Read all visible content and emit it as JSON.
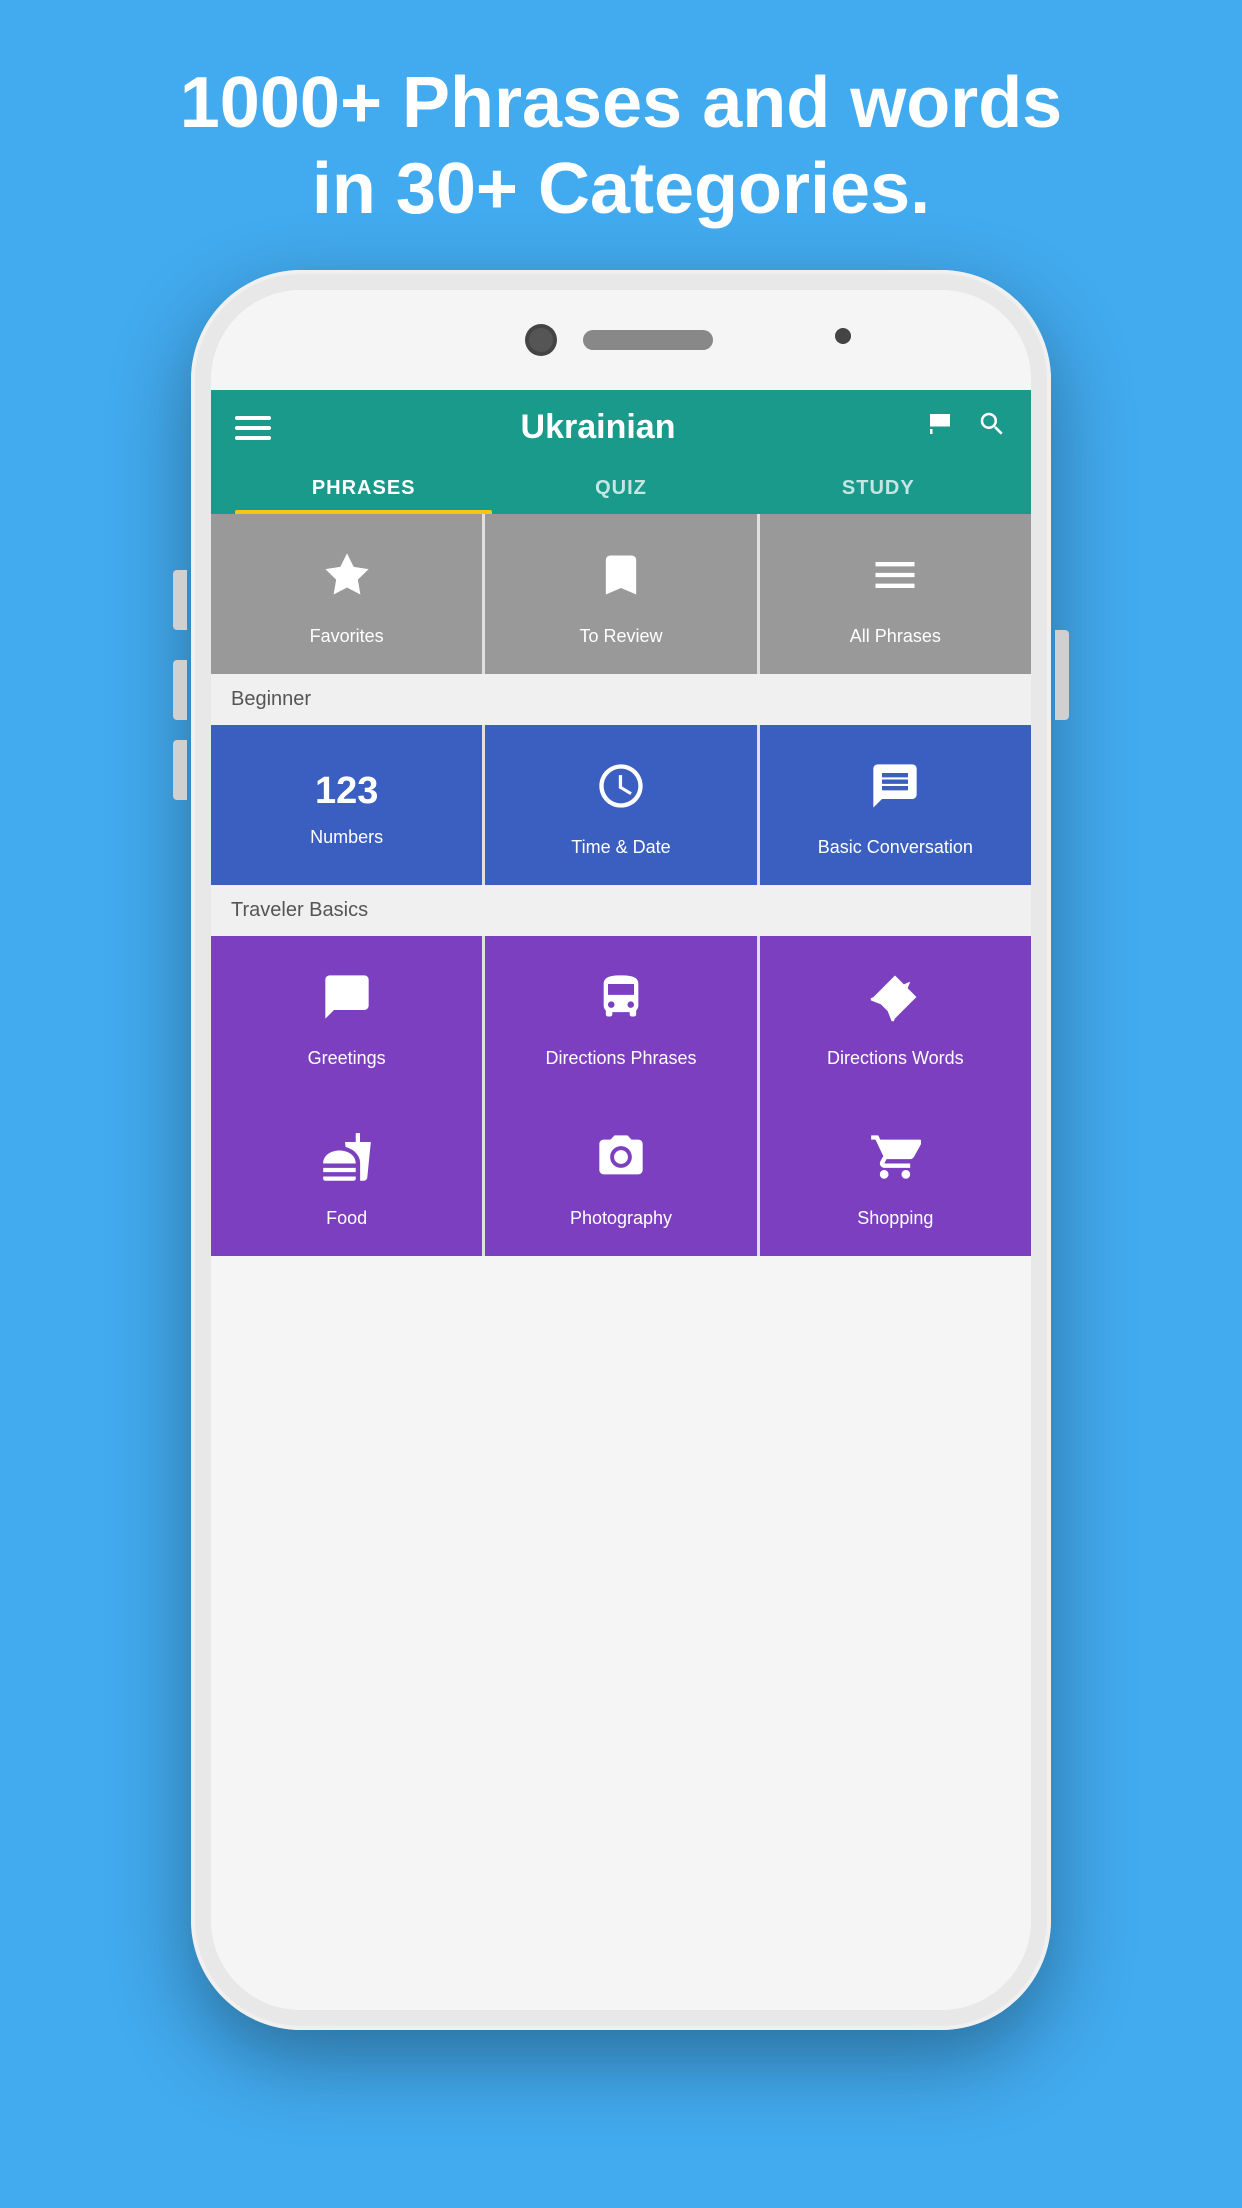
{
  "headline": {
    "line1": "1000+ Phrases and words",
    "line2": "in 30+ Categories."
  },
  "header": {
    "title": "Ukrainian",
    "flag_icon_label": "flag-icon",
    "search_icon_label": "search-icon",
    "menu_icon_label": "menu-icon"
  },
  "tabs": [
    {
      "id": "phrases",
      "label": "PHRASES",
      "active": true
    },
    {
      "id": "quiz",
      "label": "QUIZ",
      "active": false
    },
    {
      "id": "study",
      "label": "STUDY",
      "active": false
    }
  ],
  "grid_top": [
    {
      "id": "favorites",
      "label": "Favorites",
      "icon": "star",
      "color": "gray"
    },
    {
      "id": "to-review",
      "label": "To Review",
      "icon": "bookmark",
      "color": "gray"
    },
    {
      "id": "all-phrases",
      "label": "All Phrases",
      "icon": "lines",
      "color": "gray"
    }
  ],
  "section_beginner": {
    "label": "Beginner"
  },
  "grid_beginner": [
    {
      "id": "numbers",
      "label": "Numbers",
      "icon": "123",
      "color": "blue"
    },
    {
      "id": "time-date",
      "label": "Time & Date",
      "icon": "clock",
      "color": "blue"
    },
    {
      "id": "basic-conversation",
      "label": "Basic Conversation",
      "icon": "chat",
      "color": "blue"
    }
  ],
  "section_traveler": {
    "label": "Traveler Basics"
  },
  "grid_traveler": [
    {
      "id": "greetings",
      "label": "Greetings",
      "icon": "speech",
      "color": "purple"
    },
    {
      "id": "directions-phrases",
      "label": "Directions Phrases",
      "icon": "bus",
      "color": "purple"
    },
    {
      "id": "directions-words",
      "label": "Directions Words",
      "icon": "direction",
      "color": "purple"
    }
  ],
  "grid_bottom": [
    {
      "id": "food",
      "label": "Food",
      "icon": "utensils",
      "color": "purple"
    },
    {
      "id": "photography",
      "label": "Photography",
      "icon": "camera",
      "color": "purple"
    },
    {
      "id": "shopping",
      "label": "Shopping",
      "icon": "cart",
      "color": "purple"
    }
  ]
}
